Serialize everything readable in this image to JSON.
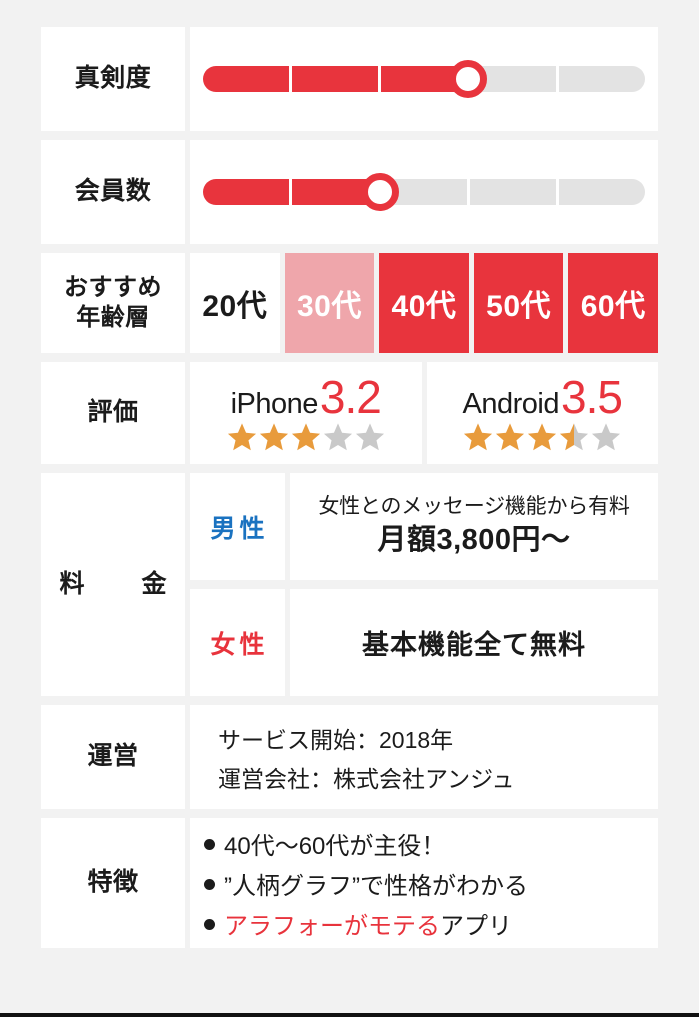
{
  "table": {
    "rows": [
      {
        "label": "真剣度",
        "type": "slider",
        "segments": 5,
        "filled": 3
      },
      {
        "label": "会員数",
        "type": "slider",
        "segments": 5,
        "filled": 2
      },
      {
        "label_line1": "おすすめ",
        "label_line2": "年齢層",
        "type": "age",
        "cells": [
          {
            "text": "20代",
            "level": "none"
          },
          {
            "text": "30代",
            "level": "half"
          },
          {
            "text": "40代",
            "level": "full"
          },
          {
            "text": "50代",
            "level": "full"
          },
          {
            "text": "60代",
            "level": "full"
          }
        ]
      },
      {
        "label": "評価",
        "type": "rating",
        "platforms": [
          {
            "name": "iPhone",
            "score": "3.2",
            "full_stars": 3,
            "half_star": false,
            "total_stars": 5
          },
          {
            "name": "Android",
            "score": "3.5",
            "full_stars": 3,
            "half_star": true,
            "total_stars": 5
          }
        ]
      },
      {
        "label": "料　金",
        "type": "price",
        "male": {
          "gender": "男性",
          "note": "女性とのメッセージ機能から有料",
          "main": "月額3,800円〜"
        },
        "female": {
          "gender": "女性",
          "main": "基本機能全て無料"
        }
      },
      {
        "label": "運営",
        "type": "operator",
        "lines": [
          "サービス開始：2018年",
          "運営会社：株式会社アンジュ"
        ]
      },
      {
        "label": "特徴",
        "type": "features",
        "items": [
          {
            "text": "40代〜60代が主役！",
            "accent": false
          },
          {
            "text": "”人柄グラフ”で性格がわかる",
            "accent": false
          },
          {
            "text_accent": "アラフォーがモテる",
            "text_tail": "アプリ",
            "accent": true
          }
        ]
      }
    ]
  },
  "colors": {
    "accent_red": "#e8343d",
    "accent_pink": "#efa6ab",
    "track_gray": "#e3e3e3",
    "male_blue": "#1a72c0",
    "female_red": "#e8333c",
    "star_on": "#e89b3c",
    "star_off": "#c9c9c9",
    "page_bg": "#f2f2f2"
  }
}
